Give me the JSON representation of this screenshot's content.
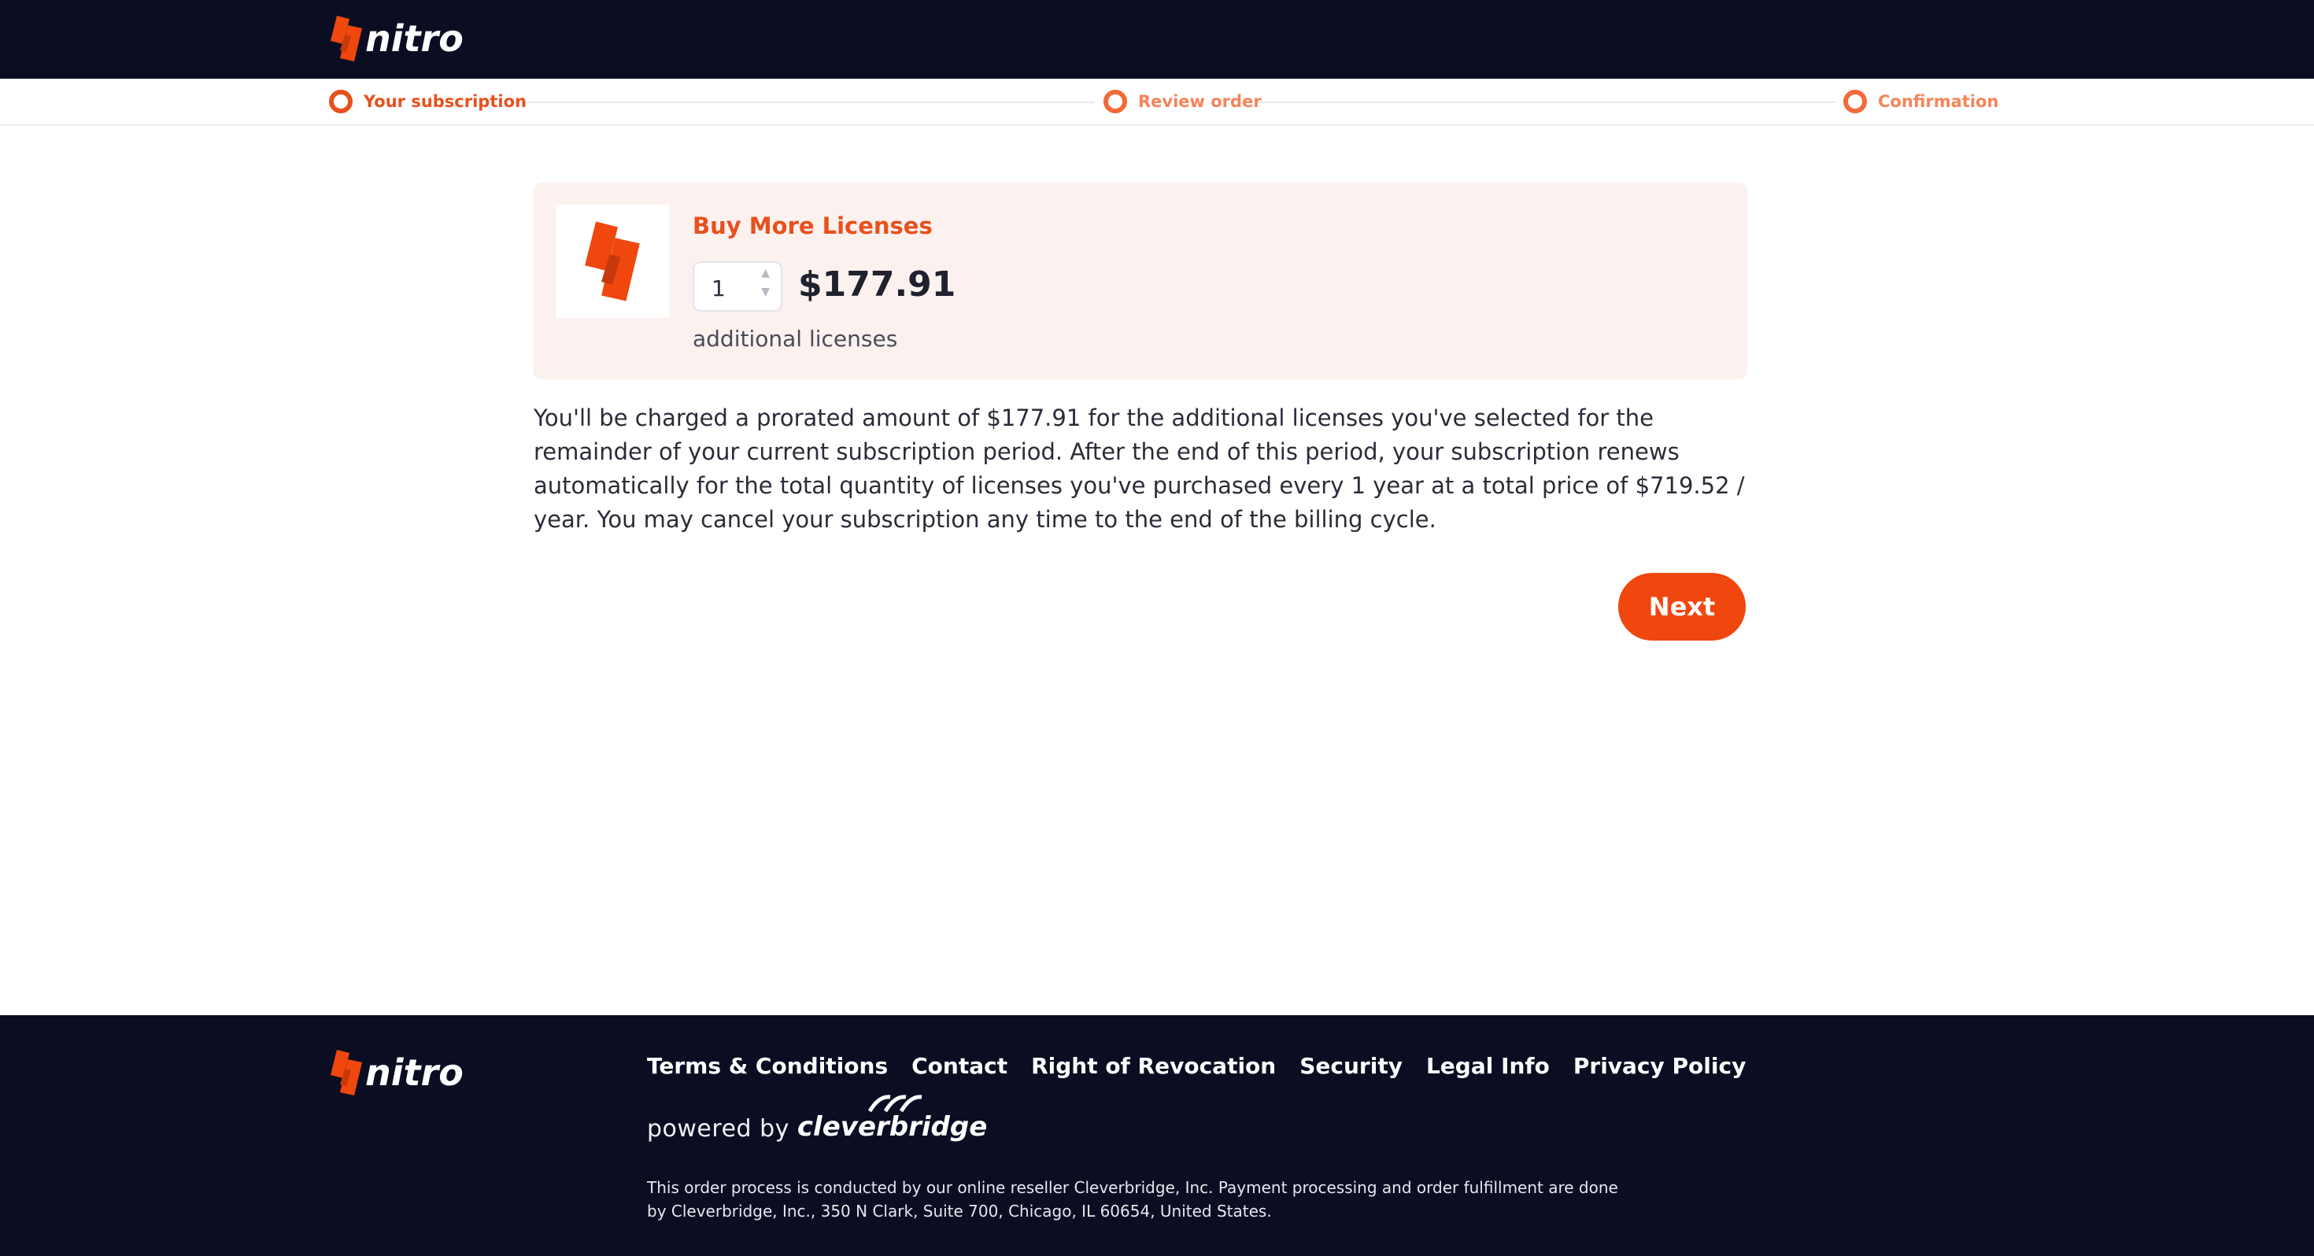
{
  "header": {
    "logo_text": "nitro"
  },
  "stepper": {
    "steps": [
      {
        "label": "Your subscription",
        "active": true
      },
      {
        "label": "Review order",
        "active": false
      },
      {
        "label": "Confirmation",
        "active": false
      }
    ]
  },
  "product": {
    "title": "Buy More Licenses",
    "quantity": "1",
    "price": "$177.91",
    "sublabel": "additional licenses"
  },
  "notice": "You'll be charged a prorated amount of $177.91 for the additional licenses you've selected for the remainder of your current subscription period. After the end of this period, your subscription renews automatically for the total quantity of licenses you've purchased every 1 year at a total price of $719.52 / year. You may cancel your subscription any time to the end of the billing cycle.",
  "actions": {
    "next_label": "Next"
  },
  "footer": {
    "logo_text": "nitro",
    "links": [
      "Terms & Conditions",
      "Contact",
      "Right of Revocation",
      "Security",
      "Legal Info",
      "Privacy Policy"
    ],
    "powered_prefix": "powered by",
    "powered_brand": "cleverbridge",
    "legal": "This order process is conducted by our online reseller Cleverbridge, Inc. Payment processing and order fulfillment are done by Cleverbridge, Inc., 350 N Clark, Suite 700, Chicago, IL 60654, United States."
  },
  "colors": {
    "brand_orange": "#f0470f",
    "header_bg": "#0b0e22",
    "card_bg": "#fbf1ef"
  }
}
